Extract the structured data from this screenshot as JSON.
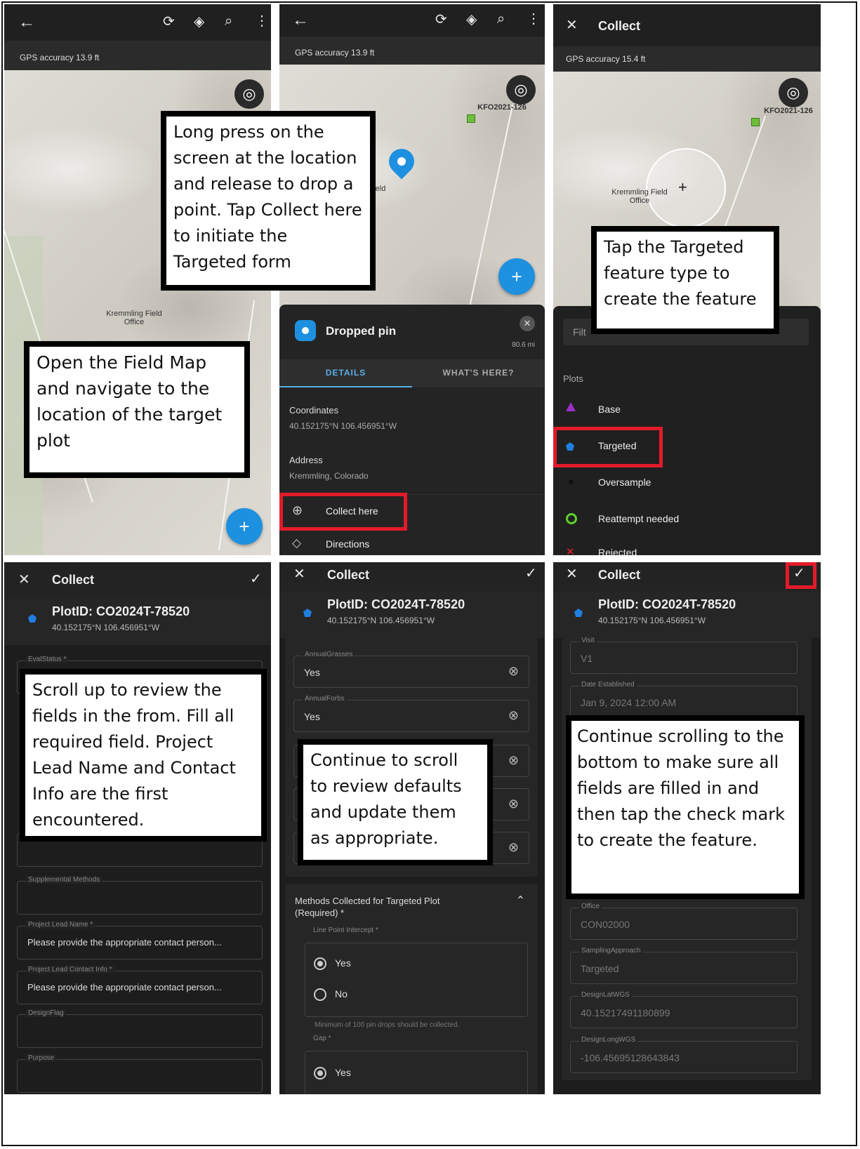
{
  "panel1": {
    "gps": "GPS accuracy 13.9 ft",
    "map_label": "Kremmling Field Office",
    "fab": "+",
    "callout": "Open the Field Map and navigate to the location of the target plot"
  },
  "panel2": {
    "gps": "GPS accuracy 13.9 ft",
    "map_label": "KFO2021-126",
    "map_partial": "eld",
    "sheet_title": "Dropped pin",
    "distance": "80.6 mi",
    "tabs": [
      "DETAILS",
      "WHAT'S HERE?"
    ],
    "coord_label": "Coordinates",
    "coord_value": "40.152175°N  106.456951°W",
    "address_label": "Address",
    "address_value": "Kremmling, Colorado",
    "collect_label": "Collect here",
    "directions_label": "Directions",
    "callout": "Long press on the screen at the location and release to drop a point. Tap Collect here to initiate the Targeted form"
  },
  "panel3": {
    "title": "Collect",
    "gps": "GPS accuracy 15.4 ft",
    "map_label": "KFO2021-126",
    "map_label2": "Kremmling Field Office",
    "filter_partial": "Filt",
    "section": "Plots",
    "items": [
      "Base",
      "Targeted",
      "Oversample",
      "Reattempt needed",
      "Rejected"
    ],
    "callout": "Tap the Targeted feature type to create the feature"
  },
  "panel4": {
    "title": "Collect",
    "plot_id": "PlotID: CO2024T-78520",
    "plot_coord": "40.152175°N  106.456951°W",
    "fields": [
      {
        "label": "EvalStatus *",
        "value": ""
      },
      {
        "label": "Supplemental Methods",
        "value": ""
      },
      {
        "label": "Project Lead Name *",
        "value": "Please provide the appropriate contact person..."
      },
      {
        "label": "Project Lead Contact Info *",
        "value": "Please provide the appropriate contact person..."
      },
      {
        "label": "DesignFlag",
        "value": ""
      },
      {
        "label": "Purpose",
        "value": ""
      }
    ],
    "callout": "Scroll up to review the fields in the from. Fill all required field. Project Lead Name and Contact Info are the first encountered."
  },
  "panel5": {
    "title": "Collect",
    "plot_id": "PlotID: CO2024T-78520",
    "plot_coord": "40.152175°N  106.456951°W",
    "fields": [
      {
        "label": "AnnualGrasses",
        "value": "Yes"
      },
      {
        "label": "AnnualForbs",
        "value": "Yes"
      }
    ],
    "group_title": "Methods Collected for Targeted Plot (Required) *",
    "lpi_label": "Line Point Intercept *",
    "opt_yes": "Yes",
    "opt_no": "No",
    "hint": "Minimum of 100 pin drops should be collected.",
    "gap_label": "Gap *",
    "gap_yes": "Yes",
    "callout": "Continue to scroll to review defaults and update them as appropriate."
  },
  "panel6": {
    "title": "Collect",
    "plot_id": "PlotID: CO2024T-78520",
    "plot_coord": "40.152175°N  106.456951°W",
    "fields": [
      {
        "label": "Visit",
        "value": "V1"
      },
      {
        "label": "Date Established",
        "value": "Jan 9, 2024 12:00 AM"
      },
      {
        "label": "Office",
        "value": "CON02000"
      },
      {
        "label": "SamplingApproach",
        "value": "Targeted"
      },
      {
        "label": "DesignLatWGS",
        "value": "40.15217491180899"
      },
      {
        "label": "DesignLongWGS",
        "value": "-106.45695128643843"
      }
    ],
    "callout": "Continue scrolling to the bottom to make sure all fields are filled in and then tap the check mark to create the feature."
  },
  "colors": {
    "accent": "#1e90e0",
    "highlight": "#e21b2b",
    "dark_bg": "#232323"
  }
}
